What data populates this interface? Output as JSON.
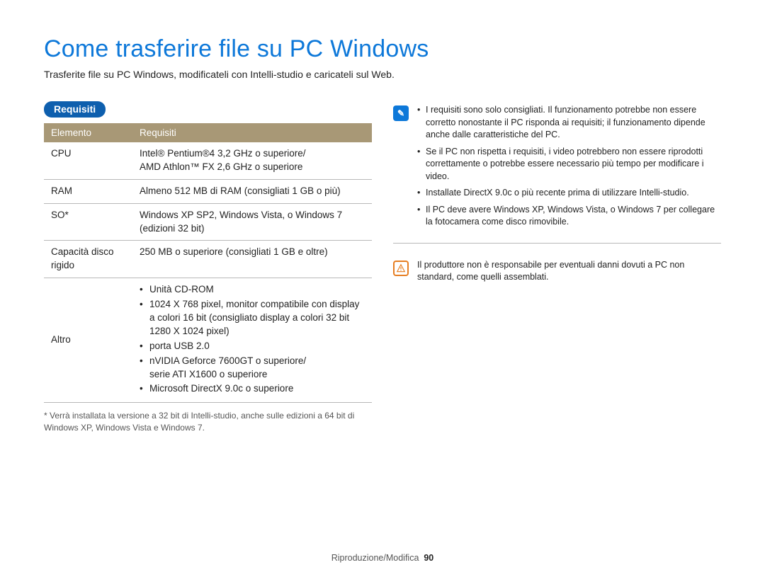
{
  "title": "Come trasferire file su PC Windows",
  "subtitle": "Trasferite file su PC Windows, modificateli con Intelli-studio e caricateli sul Web.",
  "requirements": {
    "label": "Requisiti",
    "columns": {
      "element": "Elemento",
      "requirement": "Requisiti"
    },
    "rows": {
      "cpu": {
        "label": "CPU",
        "value": "Intel® Pentium®4 3,2 GHz o superiore/\nAMD Athlon™ FX 2,6 GHz o superiore"
      },
      "ram": {
        "label": "RAM",
        "value": "Almeno 512 MB di RAM (consigliati 1 GB o più)"
      },
      "os": {
        "label": "SO*",
        "value": "Windows XP SP2, Windows Vista, o Windows 7 (edizioni 32 bit)"
      },
      "hdd": {
        "label": "Capacità disco rigido",
        "value": "250 MB o superiore (consigliati 1 GB e oltre)"
      },
      "other": {
        "label": "Altro",
        "items": [
          "Unità CD-ROM",
          "1024 X 768 pixel, monitor compatibile con display a colori 16 bit (consigliato display a colori 32 bit 1280 X 1024 pixel)",
          "porta USB 2.0",
          "nVIDIA Geforce 7600GT o superiore/\nserie ATI X1600 o superiore",
          "Microsoft DirectX 9.0c o superiore"
        ]
      }
    },
    "footnote": "* Verrà installata la versione a 32 bit di Intelli-studio, anche sulle edizioni a 64 bit di Windows XP, Windows Vista e Windows 7."
  },
  "info_notes": [
    "I requisiti sono solo consigliati. Il funzionamento potrebbe non essere corretto nonostante il PC risponda ai requisiti; il funzionamento dipende anche dalle caratteristiche del PC.",
    "Se il PC non rispetta i requisiti, i video potrebbero non essere riprodotti correttamente o potrebbe essere necessario più tempo per modificare i video.",
    "Installate DirectX 9.0c o più recente prima di utilizzare Intelli-studio.",
    "Il PC deve avere Windows XP, Windows Vista, o Windows 7 per collegare la fotocamera come disco rimovibile."
  ],
  "warn_note": "Il produttore non è responsabile per eventuali danni dovuti a PC non standard, come quelli assemblati.",
  "footer": {
    "section": "Riproduzione/Modifica",
    "page": "90"
  },
  "icons": {
    "info_glyph": "✎",
    "warn_glyph_name": "warning-triangle-icon"
  }
}
